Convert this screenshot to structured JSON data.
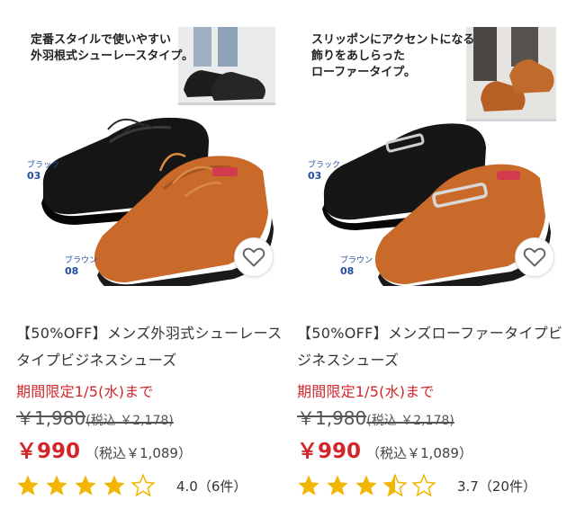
{
  "products": [
    {
      "caption": [
        "定番スタイルで使いやすい",
        "外羽根式シューレースタイプ。"
      ],
      "color_labels": [
        {
          "label": "ブラック",
          "code": "03"
        },
        {
          "label": "ブラウン",
          "code": "08"
        }
      ],
      "title": "【50%OFF】メンズ外羽式シューレースタイプビジネスシューズ",
      "limited_offer": "期間限定1/5(水)まで",
      "original_price": "￥1,980",
      "original_price_tax": "(税込 ￥2,178)",
      "sale_price": "￥990",
      "sale_price_tax": "（税込￥1,089）",
      "rating_value": 4.0,
      "rating_text": "4.0（6件）",
      "favorite_icon": "heart-outline-icon"
    },
    {
      "caption": [
        "スリッポンにアクセントになる",
        "飾りをあしらった",
        "ローファータイプ。"
      ],
      "color_labels": [
        {
          "label": "ブラック",
          "code": "03"
        },
        {
          "label": "ブラウン",
          "code": "08"
        }
      ],
      "title": "【50%OFF】メンズローファータイプビジネスシューズ",
      "limited_offer": "期間限定1/5(水)まで",
      "original_price": "￥1,980",
      "original_price_tax": "(税込 ￥2,178)",
      "sale_price": "￥990",
      "sale_price_tax": "（税込￥1,089）",
      "rating_value": 3.7,
      "rating_text": "3.7（20件）",
      "favorite_icon": "heart-outline-icon"
    }
  ],
  "colors": {
    "sale_red": "#d2262a",
    "star_gold": "#f2b705",
    "label_blue": "#1f4fa0"
  }
}
